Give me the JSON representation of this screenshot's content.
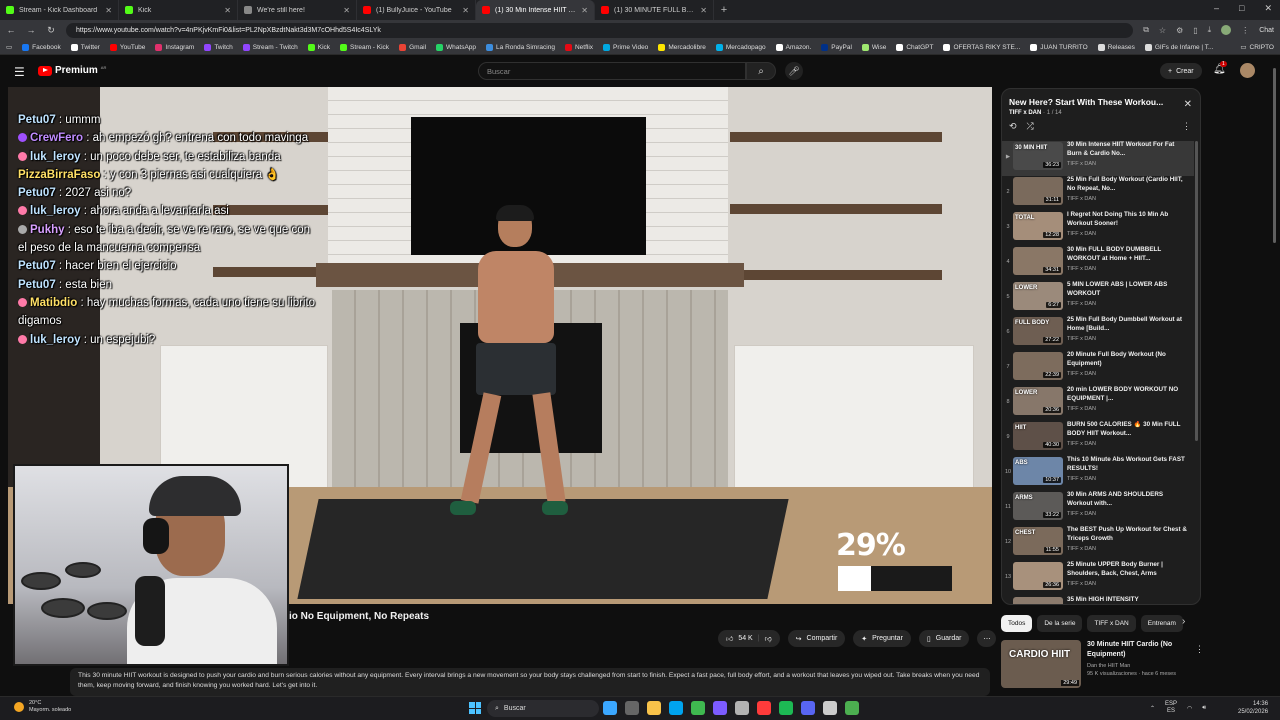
{
  "browser": {
    "tabs": [
      {
        "label": "Stream - Kick Dashboard",
        "color": "#53fc18",
        "active": false
      },
      {
        "label": "Kick",
        "color": "#53fc18",
        "active": false
      },
      {
        "label": "We're still here!",
        "color": "#888888",
        "active": false
      },
      {
        "label": "(1) BullyJuice - YouTube",
        "color": "#ff0000",
        "active": false
      },
      {
        "label": "(1) 30 Min Intense HIIT Workout F",
        "color": "#ff0000",
        "active": true
      },
      {
        "label": "(1) 30 MINUTE FULL BODY BLAST",
        "color": "#ff0000",
        "active": false
      }
    ],
    "new_tab": "+",
    "window_controls": [
      "–",
      "□",
      "✕"
    ],
    "url": "https://www.youtube.com/watch?v=4nPKjvKmFi0&list=PL2NpXBzdtNakt3d3M7cOHhd5S4Ic4SLYk",
    "chat_button": "Chat",
    "bookmarks": [
      {
        "label": "Facebook",
        "color": "#1877f2"
      },
      {
        "label": "Twitter",
        "color": "#ffffff"
      },
      {
        "label": "YouTube",
        "color": "#ff0000"
      },
      {
        "label": "Instagram",
        "color": "#e1306c"
      },
      {
        "label": "Twitch",
        "color": "#9146ff"
      },
      {
        "label": "Stream - Twitch",
        "color": "#9146ff"
      },
      {
        "label": "Kick",
        "color": "#53fc18"
      },
      {
        "label": "Stream - Kick",
        "color": "#53fc18"
      },
      {
        "label": "Gmail",
        "color": "#ea4335"
      },
      {
        "label": "WhatsApp",
        "color": "#25d366"
      },
      {
        "label": "La Ronda Simracing",
        "color": "#3c8dde"
      },
      {
        "label": "Netflix",
        "color": "#e50914"
      },
      {
        "label": "Prime Video",
        "color": "#00a8e1"
      },
      {
        "label": "Mercadolibre",
        "color": "#ffe600"
      },
      {
        "label": "Mercadopago",
        "color": "#00b1ea"
      },
      {
        "label": "Amazon.",
        "color": "#ffffff"
      },
      {
        "label": "PayPal",
        "color": "#003087"
      },
      {
        "label": "Wise",
        "color": "#9fe870"
      },
      {
        "label": "ChatGPT",
        "color": "#ffffff"
      },
      {
        "label": "OFERTAS RIKY STE...",
        "color": "#ffffff"
      },
      {
        "label": "JUAN TURRITO",
        "color": "#ffffff"
      },
      {
        "label": "Releases",
        "color": "#dddddd"
      },
      {
        "label": "GIFs de Infame | T...",
        "color": "#dddddd"
      }
    ],
    "bookmark_folder": "CRIPTO"
  },
  "youtube": {
    "logo_text": "Premium",
    "logo_region": "AR",
    "search_placeholder": "Buscar",
    "create_label": "Crear",
    "notif_count": "1"
  },
  "chat": [
    {
      "user": "Petu07",
      "text": ": ummm",
      "color": "#bfe3ff",
      "badge": ""
    },
    {
      "user": "CrewFero",
      "text": ": ah empezó gh? entrena con todo mavinga",
      "color": "#c08cff",
      "badge": "purple"
    },
    {
      "user": "luk_leroy",
      "text": ": un poco debe ser, te estabiliza banda",
      "color": "#bfe3ff",
      "badge": "pink"
    },
    {
      "user": "PizzaBirraFaso",
      "text": ": y con 3 piernas asi cualquiera 👌",
      "color": "#ffe066",
      "badge": ""
    },
    {
      "user": "Petu07",
      "text": ": 2027 asi no?",
      "color": "#bfe3ff",
      "badge": ""
    },
    {
      "user": "luk_leroy",
      "text": ": ahora anda a levantarla asi",
      "color": "#bfe3ff",
      "badge": "pink"
    },
    {
      "user": "Pukhy",
      "text": ": eso te iba a decir, se ve re raro, se ve que con el peso de la mancuerna compensa",
      "color": "#d9a0ff",
      "badge": "gray"
    },
    {
      "user": "Petu07",
      "text": ": hacer bien el ejercicio",
      "color": "#bfe3ff",
      "badge": ""
    },
    {
      "user": "Petu07",
      "text": ": esta bien",
      "color": "#bfe3ff",
      "badge": ""
    },
    {
      "user": "Matibdio",
      "text": ": hay muchas formas, cada uno tiene su librito digamos",
      "color": "#ffe066",
      "badge": "pink"
    },
    {
      "user": "luk_leroy",
      "text": ": un espejubi?",
      "color": "#bfe3ff",
      "badge": "pink"
    }
  ],
  "video": {
    "title": "io No Equipment, No Repeats",
    "progress_label": "29%",
    "progress_fraction": 0.29,
    "likes": "54 K",
    "share_label": "Compartir",
    "ask_label": "Preguntar",
    "save_label": "Guardar",
    "description": "This 30 minute HIIT workout is designed to push your cardio and burn serious calories without any equipment. Every interval brings a new movement so your body stays challenged from start to finish. Expect a fast pace, full body effort, and a workout that leaves you wiped out. Take breaks when you need them, keep moving forward, and finish knowing you worked hard. Let's get into it."
  },
  "playlist": {
    "title": "New Here? Start With These Workou...",
    "channel": "TIFF x DAN",
    "position": "1 / 14",
    "items": [
      {
        "idx": "▶",
        "title": "30 Min Intense HIIT Workout For Fat Burn & Cardio No...",
        "channel": "TIFF x DAN",
        "duration": "36:23",
        "thumb": "#4a4a4a",
        "label": "30 MIN HIIT"
      },
      {
        "idx": "2",
        "title": "25 Min Full Body Workout (Cardio HIIT, No Repeat, No...",
        "channel": "TIFF x DAN",
        "duration": "31:11",
        "thumb": "#7a6a5c",
        "label": ""
      },
      {
        "idx": "3",
        "title": "I Regret Not Doing This 10 Min Ab Workout Sooner!",
        "channel": "TIFF x DAN",
        "duration": "12:28",
        "thumb": "#a58e7a",
        "label": "TOTAL"
      },
      {
        "idx": "4",
        "title": "30 Min FULL BODY DUMBBELL WORKOUT at Home + HIIT...",
        "channel": "TIFF x DAN",
        "duration": "34:31",
        "thumb": "#8a7766",
        "label": ""
      },
      {
        "idx": "5",
        "title": "5 MIN LOWER ABS | LOWER ABS WORKOUT",
        "channel": "TIFF x DAN",
        "duration": "6:27",
        "thumb": "#9b8a7b",
        "label": "LOWER"
      },
      {
        "idx": "6",
        "title": "25 Min Full Body Dumbbell Workout at Home [Build...",
        "channel": "TIFF x DAN",
        "duration": "27:22",
        "thumb": "#6e5e52",
        "label": "FULL BODY"
      },
      {
        "idx": "7",
        "title": "20 Minute Full Body Workout (No Equipment)",
        "channel": "TIFF x DAN",
        "duration": "22:39",
        "thumb": "#7d6c5d",
        "label": ""
      },
      {
        "idx": "8",
        "title": "20 min LOWER BODY WORKOUT NO EQUIPMENT |...",
        "channel": "TIFF x DAN",
        "duration": "20:36",
        "thumb": "#87776a",
        "label": "LOWER"
      },
      {
        "idx": "9",
        "title": "BURN 500 CALORIES 🔥 30 Min FULL BODY HIIT Workout...",
        "channel": "TIFF x DAN",
        "duration": "40:30",
        "thumb": "#5e5048",
        "label": "HIIT"
      },
      {
        "idx": "10",
        "title": "This 10 Minute Abs Workout Gets FAST RESULTS!",
        "channel": "TIFF x DAN",
        "duration": "10:37",
        "thumb": "#6d86a8",
        "label": "ABS"
      },
      {
        "idx": "11",
        "title": "30 Min ARMS AND SHOULDERS Workout with...",
        "channel": "TIFF x DAN",
        "duration": "33:22",
        "thumb": "#5c5a58",
        "label": "ARMS"
      },
      {
        "idx": "12",
        "title": "The BEST Push Up Workout for Chest & Triceps Growth",
        "channel": "TIFF x DAN",
        "duration": "11:55",
        "thumb": "#7b6a5b",
        "label": "CHEST"
      },
      {
        "idx": "13",
        "title": "25 Minute UPPER Body Burner | Shoulders, Back, Chest, Arms",
        "channel": "TIFF x DAN",
        "duration": "26:36",
        "thumb": "#a8917c",
        "label": ""
      },
      {
        "idx": "14",
        "title": "35 Min HIGH INTENSITY",
        "channel": "",
        "duration": "",
        "thumb": "#8c7b6d",
        "label": ""
      }
    ]
  },
  "chips": [
    {
      "label": "Todos",
      "active": true
    },
    {
      "label": "De la serie",
      "active": false
    },
    {
      "label": "TIFF x DAN",
      "active": false
    },
    {
      "label": "Entrenam",
      "active": false
    }
  ],
  "recommendation": {
    "title": "30 Minute HIIT Cardio (No Equipment)",
    "channel": "Dan the HIIT Man",
    "meta": "95 K visualizaciones · hace 6 meses",
    "duration": "29:49",
    "thumb_label": "CARDIO HIIT"
  },
  "taskbar": {
    "temp": "20°C",
    "weather": "Mayorm. soleado",
    "search": "Buscar",
    "lang": "ESP",
    "lang2": "ES",
    "time": "14:36",
    "date": "25/02/2026",
    "apps": [
      "#3ba7ff",
      "#666666",
      "#f8c24a",
      "#00a4ef",
      "#3fb950",
      "#7c5cff",
      "#b2b2b2",
      "#ff3b3b",
      "#1db954",
      "#5865f2",
      "#cccccc",
      "#4caf50"
    ]
  }
}
